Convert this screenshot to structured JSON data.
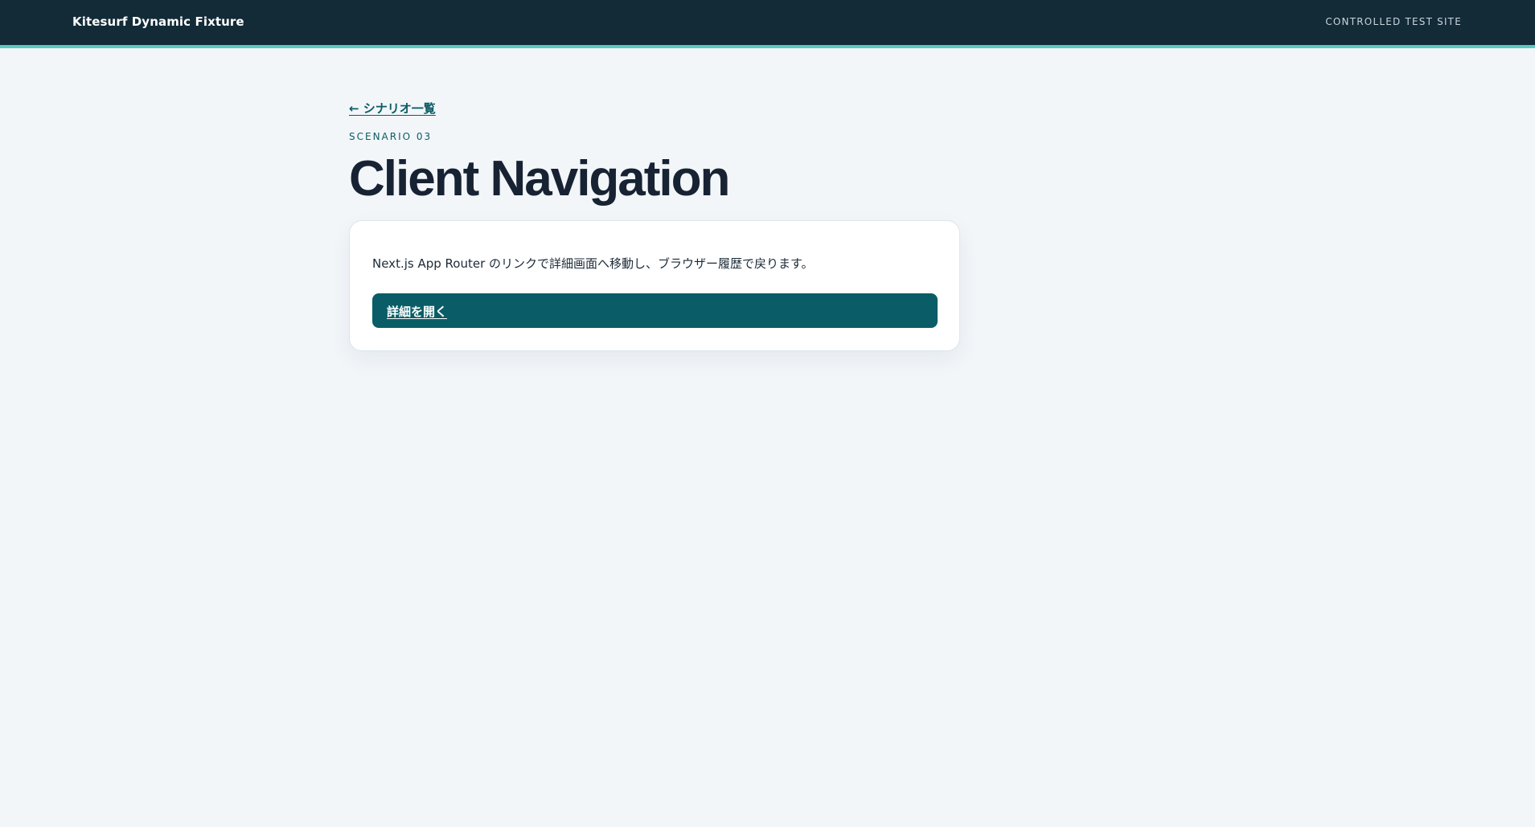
{
  "header": {
    "brand": "Kitesurf Dynamic Fixture",
    "tag": "CONTROLLED TEST SITE"
  },
  "main": {
    "back_link": "← シナリオ一覧",
    "eyebrow": "SCENARIO 03",
    "title": "Client Navigation",
    "card": {
      "description": "Next.js App Router のリンクで詳細画面へ移動し、ブラウザー履歴で戻ります。",
      "button_label": "詳細を開く"
    }
  },
  "colors": {
    "header_bg": "#132a37",
    "header_accent": "#5ac9c0",
    "page_bg": "#f2f6f9",
    "primary": "#0a5d67",
    "title_text": "#172233"
  }
}
